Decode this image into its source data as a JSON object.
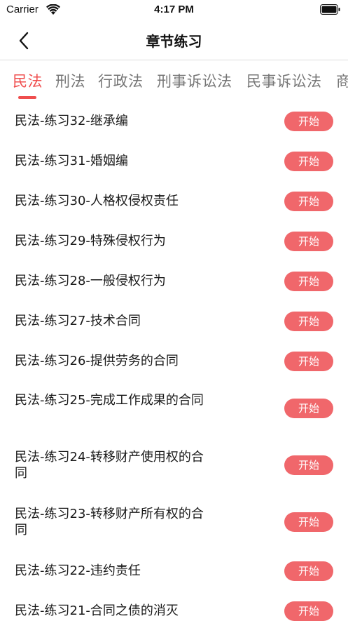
{
  "status_bar": {
    "carrier": "Carrier",
    "time": "4:17 PM"
  },
  "nav": {
    "title": "章节练习"
  },
  "tabs": [
    {
      "label": "民法",
      "active": true
    },
    {
      "label": "刑法",
      "active": false
    },
    {
      "label": "行政法",
      "active": false
    },
    {
      "label": "刑事诉讼法",
      "active": false
    },
    {
      "label": "民事诉讼法",
      "active": false
    },
    {
      "label": "商",
      "active": false
    }
  ],
  "colors": {
    "accent": "#ef4e4e",
    "button": "#f0676b"
  },
  "items": [
    {
      "title": "民法-练习32-继承编",
      "button": "开始"
    },
    {
      "title": "民法-练习31-婚姻编",
      "button": "开始"
    },
    {
      "title": "民法-练习30-人格权侵权责任",
      "button": "开始"
    },
    {
      "title": "民法-练习29-特殊侵权行为",
      "button": "开始"
    },
    {
      "title": "民法-练习28-一般侵权行为",
      "button": "开始"
    },
    {
      "title": "民法-练习27-技术合同",
      "button": "开始"
    },
    {
      "title": "民法-练习26-提供劳务的合同",
      "button": "开始"
    },
    {
      "title": "民法-练习25-完成工作成果的合同",
      "button": "开始"
    },
    {
      "title": "民法-练习24-转移财产使用权的合同",
      "button": "开始"
    },
    {
      "title": "民法-练习23-转移财产所有权的合同",
      "button": "开始"
    },
    {
      "title": "民法-练习22-违约责任",
      "button": "开始"
    },
    {
      "title": "民法-练习21-合同之债的消灭",
      "button": "开始"
    }
  ]
}
